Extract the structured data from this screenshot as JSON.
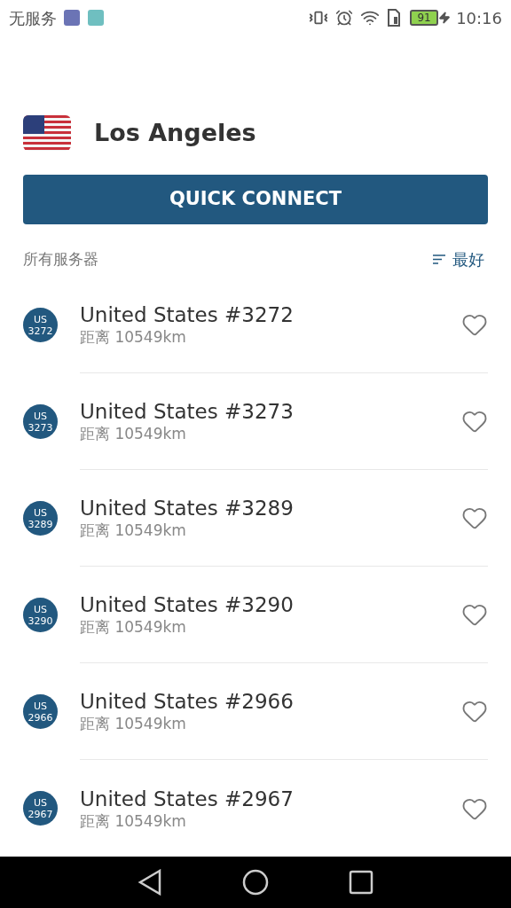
{
  "status_bar": {
    "carrier": "无服务",
    "battery": "91",
    "time": "10:16"
  },
  "location": {
    "name": "Los Angeles"
  },
  "quick_connect": {
    "label": "QUICK CONNECT"
  },
  "list_header": {
    "title": "所有服务器",
    "sort": "最好"
  },
  "servers": [
    {
      "badge_country": "US",
      "badge_number": "3272",
      "name": "United States #3272",
      "distance": "距离 10549km",
      "favorite": false
    },
    {
      "badge_country": "US",
      "badge_number": "3273",
      "name": "United States #3273",
      "distance": "距离 10549km",
      "favorite": false
    },
    {
      "badge_country": "US",
      "badge_number": "3289",
      "name": "United States #3289",
      "distance": "距离 10549km",
      "favorite": false
    },
    {
      "badge_country": "US",
      "badge_number": "3290",
      "name": "United States #3290",
      "distance": "距离 10549km",
      "favorite": false
    },
    {
      "badge_country": "US",
      "badge_number": "2966",
      "name": "United States #2966",
      "distance": "距离 10549km",
      "favorite": false
    },
    {
      "badge_country": "US",
      "badge_number": "2967",
      "name": "United States #2967",
      "distance": "距离 10549km",
      "favorite": false
    }
  ]
}
